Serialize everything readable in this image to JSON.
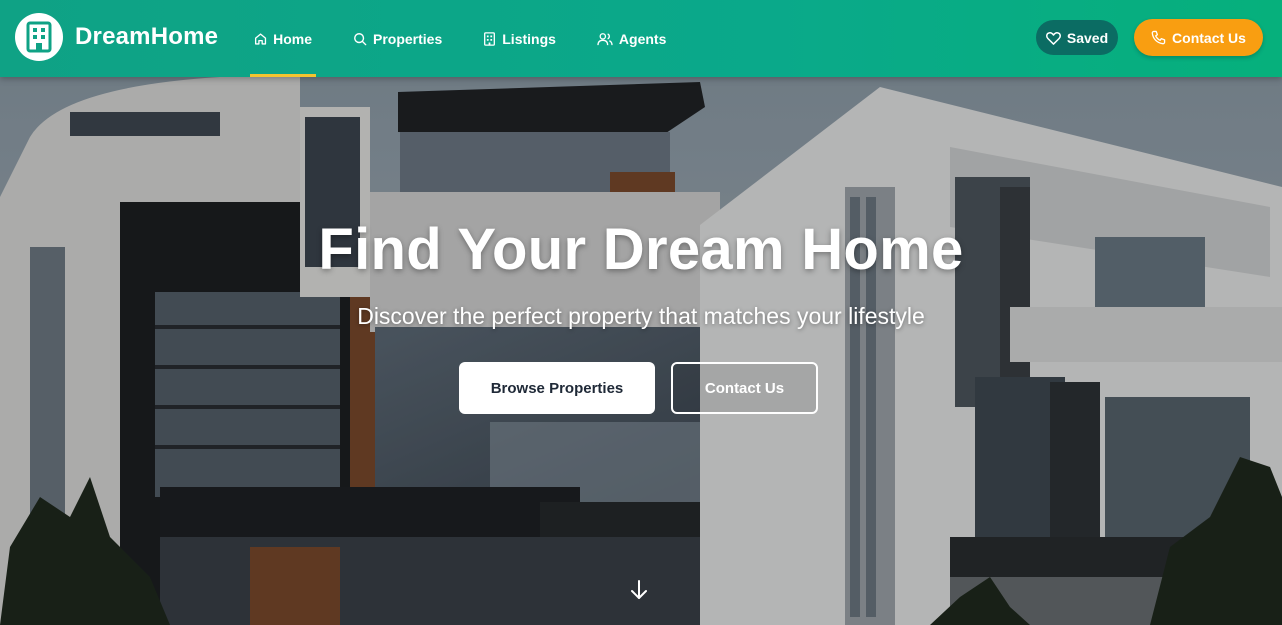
{
  "brand": {
    "name": "DreamHome",
    "icon": "building-icon"
  },
  "nav": {
    "items": [
      {
        "label": "Home",
        "icon": "home-icon",
        "active": true
      },
      {
        "label": "Properties",
        "icon": "search-icon",
        "active": false
      },
      {
        "label": "Listings",
        "icon": "building-icon",
        "active": false
      },
      {
        "label": "Agents",
        "icon": "users-icon",
        "active": false
      }
    ]
  },
  "actions": {
    "saved_label": "Saved",
    "saved_icon": "heart-icon",
    "contact_label": "Contact Us",
    "contact_icon": "phone-icon"
  },
  "hero": {
    "title": "Find Your Dream Home",
    "subtitle": "Discover the perfect property that matches your lifestyle",
    "browse_label": "Browse Properties",
    "contact_label": "Contact Us",
    "scroll_icon": "arrow-down-icon"
  },
  "colors": {
    "nav_bg": "#0aa98a",
    "active_underline": "#f4c430",
    "saved_bg": "#0b6c63",
    "contact_bg": "#f99e11"
  }
}
